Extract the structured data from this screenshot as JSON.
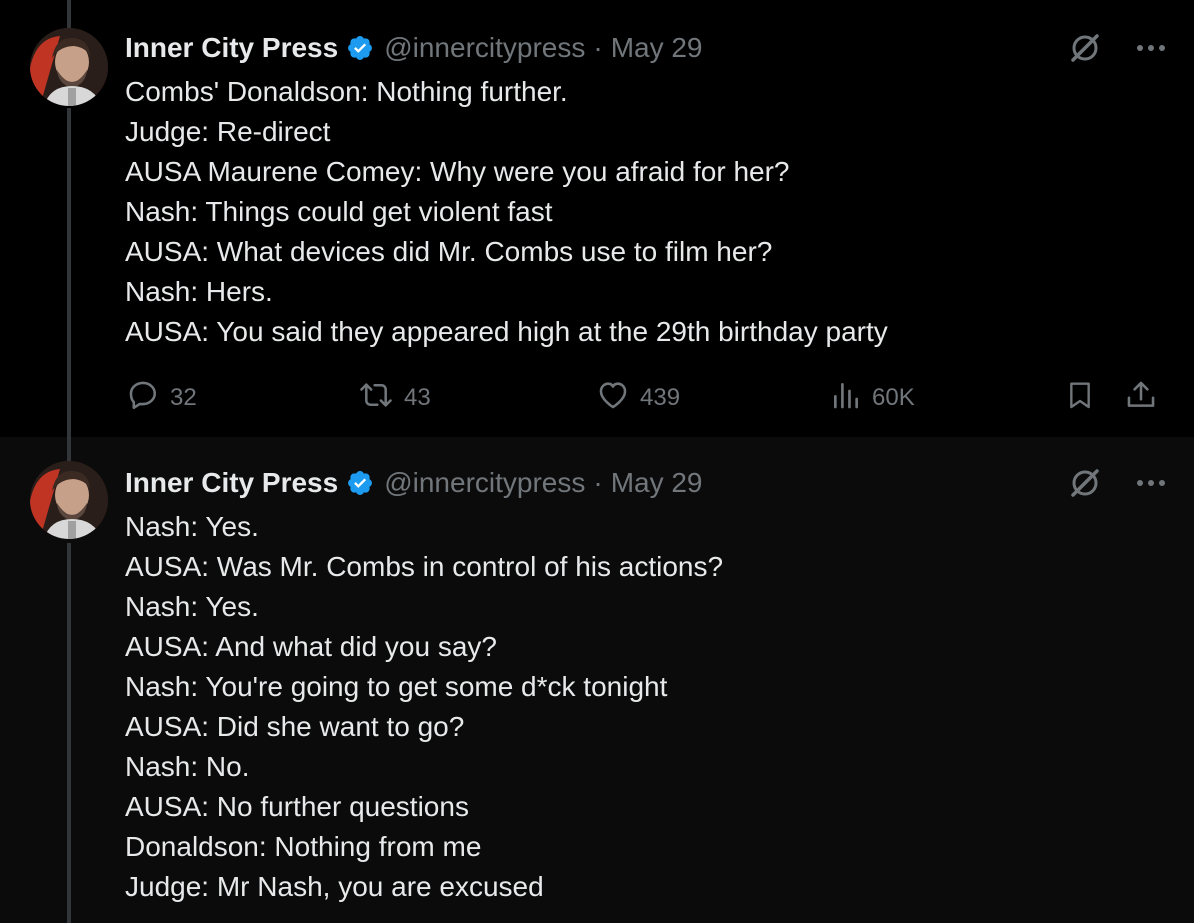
{
  "tweets": [
    {
      "author": {
        "name": "Inner City Press",
        "handle": "@innercitypress",
        "date": "May 29",
        "verified": true
      },
      "lines": [
        "Combs' Donaldson: Nothing further.",
        "Judge: Re-direct",
        "AUSA Maurene Comey: Why were you afraid for her?",
        "Nash: Things could get violent fast",
        "AUSA: What devices did Mr. Combs use to film her?",
        "Nash: Hers.",
        "AUSA: You said they appeared high at the 29th birthday party"
      ],
      "stats": {
        "replies": "32",
        "reposts": "43",
        "likes": "439",
        "views": "60K"
      }
    },
    {
      "author": {
        "name": "Inner City Press",
        "handle": "@innercitypress",
        "date": "May 29",
        "verified": true
      },
      "lines": [
        "Nash: Yes.",
        "AUSA: Was Mr. Combs in control of his actions?",
        "Nash: Yes.",
        "AUSA: And what did you say?",
        "Nash: You're going to get some d*ck tonight",
        "AUSA: Did she want to go?",
        "Nash: No.",
        "AUSA: No further questions",
        "Donaldson: Nothing from me",
        "Judge: Mr Nash, you are excused"
      ]
    }
  ],
  "separator": "·",
  "colors": {
    "accent": "#1d9bf0",
    "muted": "#71767b",
    "text": "#e7e9ea",
    "background": "#000000"
  },
  "icons": [
    "verified-badge-icon",
    "grok-icon",
    "more-icon",
    "reply-icon",
    "repost-icon",
    "like-icon",
    "views-icon",
    "bookmark-icon",
    "share-icon"
  ]
}
